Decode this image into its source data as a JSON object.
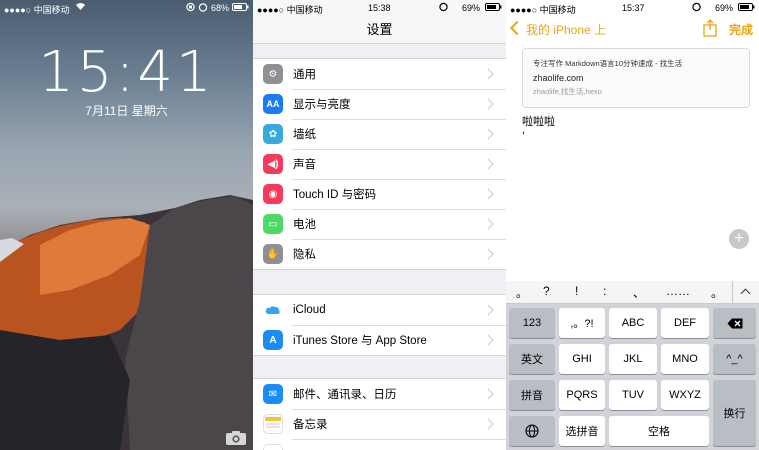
{
  "lock": {
    "carrier": "●●●●○ 中国移动",
    "battery": "68%",
    "time": "15:41",
    "date": "7月11日 星期六"
  },
  "settings": {
    "carrier": "●●●●○ 中国移动",
    "clock": "15:38",
    "battery": "69%",
    "title": "设置",
    "group1": [
      {
        "label": "通用",
        "icon": "gear-icon",
        "color": "#8e8e93"
      },
      {
        "label": "显示与亮度",
        "icon": "display-icon",
        "color": "#1a7cf5"
      },
      {
        "label": "墙纸",
        "icon": "wallpaper-icon",
        "color": "#35aadc"
      },
      {
        "label": "声音",
        "icon": "sound-icon",
        "color": "#f43b5c"
      },
      {
        "label": "Touch ID 与密码",
        "icon": "fingerprint-icon",
        "color": "#f43b5c"
      },
      {
        "label": "电池",
        "icon": "battery-icon",
        "color": "#4cd964"
      },
      {
        "label": "隐私",
        "icon": "hand-icon",
        "color": "#8e8e93"
      }
    ],
    "group2": [
      {
        "label": "iCloud",
        "icon": "cloud-icon",
        "color": "#ffffff"
      },
      {
        "label": "iTunes Store 与 App Store",
        "icon": "appstore-icon",
        "color": "#1a8cf5"
      }
    ],
    "group3": [
      {
        "label": "邮件、通讯录、日历",
        "icon": "mail-icon",
        "color": "#1a8cf5"
      },
      {
        "label": "备忘录",
        "icon": "notes-icon",
        "color": "#ffffff"
      }
    ]
  },
  "notes": {
    "carrier": "●●●●○ 中国移动",
    "clock": "15:37",
    "battery": "69%",
    "back_label": "我的 iPhone 上",
    "done_label": "完成",
    "card": {
      "title": "专注写作 Markdown语言10分钟速成 - 找生活",
      "domain": "zhaolife.com",
      "tags": "zhaolife,找生活,hexo"
    },
    "body_text": "啦啦啦",
    "body_second": ",",
    "accent": "#e9a514"
  },
  "keyboard": {
    "symbols": [
      "。",
      "?",
      "!",
      ":",
      "、",
      "……",
      "。"
    ],
    "row1": [
      "123",
      ",。?!",
      "ABC",
      "DEF"
    ],
    "row2": [
      "英文",
      "GHI",
      "JKL",
      "MNO"
    ],
    "row3": [
      "拼音",
      "PQRS",
      "TUV",
      "WXYZ"
    ],
    "row4_left": "选拼音",
    "space": "空格",
    "return": "换行",
    "face": "^_^"
  }
}
